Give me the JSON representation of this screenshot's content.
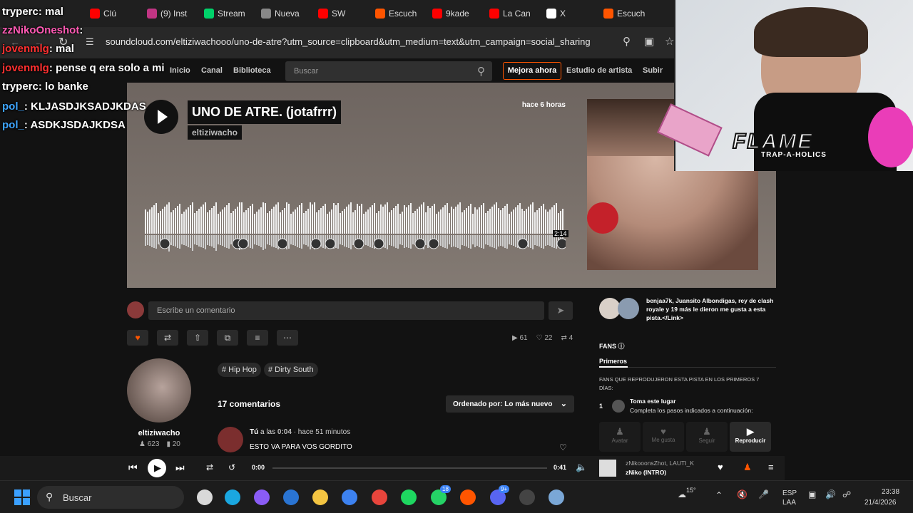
{
  "browser": {
    "tabs": [
      {
        "label": "Clú",
        "color": "#ff0000"
      },
      {
        "label": "(9) Inst",
        "color": "#c13584"
      },
      {
        "label": "Stream",
        "color": "#00d26a"
      },
      {
        "label": "Nueva",
        "color": "#888888"
      },
      {
        "label": "SW",
        "color": "#ff0000"
      },
      {
        "label": "Escuch",
        "color": "#ff5500"
      },
      {
        "label": "9kade",
        "color": "#ff0000"
      },
      {
        "label": "La Can",
        "color": "#ff0000"
      },
      {
        "label": "X",
        "color": "#ffffff"
      },
      {
        "label": "Escuch",
        "color": "#ff5500"
      }
    ],
    "url": "soundcloud.com/eltiziwachooo/uno-de-atre?utm_source=clipboard&utm_medium=text&utm_campaign=social_sharing"
  },
  "nav": {
    "home": "Inicio",
    "feed": "Canal",
    "library": "Biblioteca",
    "search_placeholder": "Buscar",
    "upgrade": "Mejora ahora",
    "artist_studio": "Estudio de artista",
    "upload": "Subir"
  },
  "track": {
    "title": "UNO DE ATRE. (jotafrrr)",
    "artist": "eltiziwacho",
    "posted": "hace 6 horas",
    "duration": "2:14"
  },
  "chat": [
    {
      "user": "tryperc",
      "msg": ": mal",
      "color": "#ffffff"
    },
    {
      "user": "zzNikoOneshot",
      "msg": ":",
      "color": "#ff5ab4"
    },
    {
      "user": "jovenmlg",
      "msg": ": mal",
      "color": "#ff3030"
    },
    {
      "user": "jovenmlg",
      "msg": ": pense q era solo a mi",
      "color": "#ff3030"
    },
    {
      "user": "tryperc",
      "msg": ": lo banke",
      "color": "#ffffff"
    },
    {
      "user": "pol_",
      "msg": ": KLJASDJKSADJKDAS",
      "color": "#3ea6ff"
    },
    {
      "user": "pol_",
      "msg": ": ASDKJSDAJKDSA",
      "color": "#3ea6ff"
    }
  ],
  "comment_placeholder": "Escribe un comentario",
  "stats": {
    "plays": "61",
    "likes": "22",
    "reposts": "4"
  },
  "tags": [
    "# Hip Hop",
    "# Dirty South"
  ],
  "uploader": {
    "name": "eltiziwacho",
    "followers": "623",
    "tracks": "20"
  },
  "comments": {
    "count_label": "17 comentarios",
    "sort_label": "Ordenado por: Lo más nuevo",
    "first": {
      "author": "Tú",
      "at_prefix": "a las",
      "at": "0:04",
      "ago": "· hace 51 minutos",
      "text": "ESTO VA PARA VOS GORDITO"
    }
  },
  "sidebar": {
    "likes_text": "benjaa7k, Juansito Albondigas, rey de clash royale y 19 más le dieron me gusta a esta pista.</Link>",
    "fans_title": "FANS",
    "fans_tab": "Primeros",
    "fans_desc": "FANS QUE REPRODUJERON ESTA PISTA EN LOS PRIMEROS 7 DÍAS:",
    "rank": "1",
    "slot_title": "Toma este lugar",
    "slot_desc": "Completa los pasos indicados a continuación:",
    "actions": [
      "Avatar",
      "Me gusta",
      "Seguir",
      "Reproducir"
    ]
  },
  "player": {
    "elapsed": "0:00",
    "total": "0:41",
    "now_artist": "zNikooonsZhot, LAUTI_K",
    "now_title": "zNiko (INTRO)"
  },
  "overlay": {
    "flame": "FLAME",
    "flame_sub": "TRAP-A-HOLICS"
  },
  "taskbar": {
    "search": "Buscar",
    "temp": "15°",
    "lang1": "ESP",
    "lang2": "LAA",
    "time": "23:38",
    "date": "21/4/2026",
    "badges": {
      "whatsapp": "18",
      "discord": "9+"
    }
  }
}
